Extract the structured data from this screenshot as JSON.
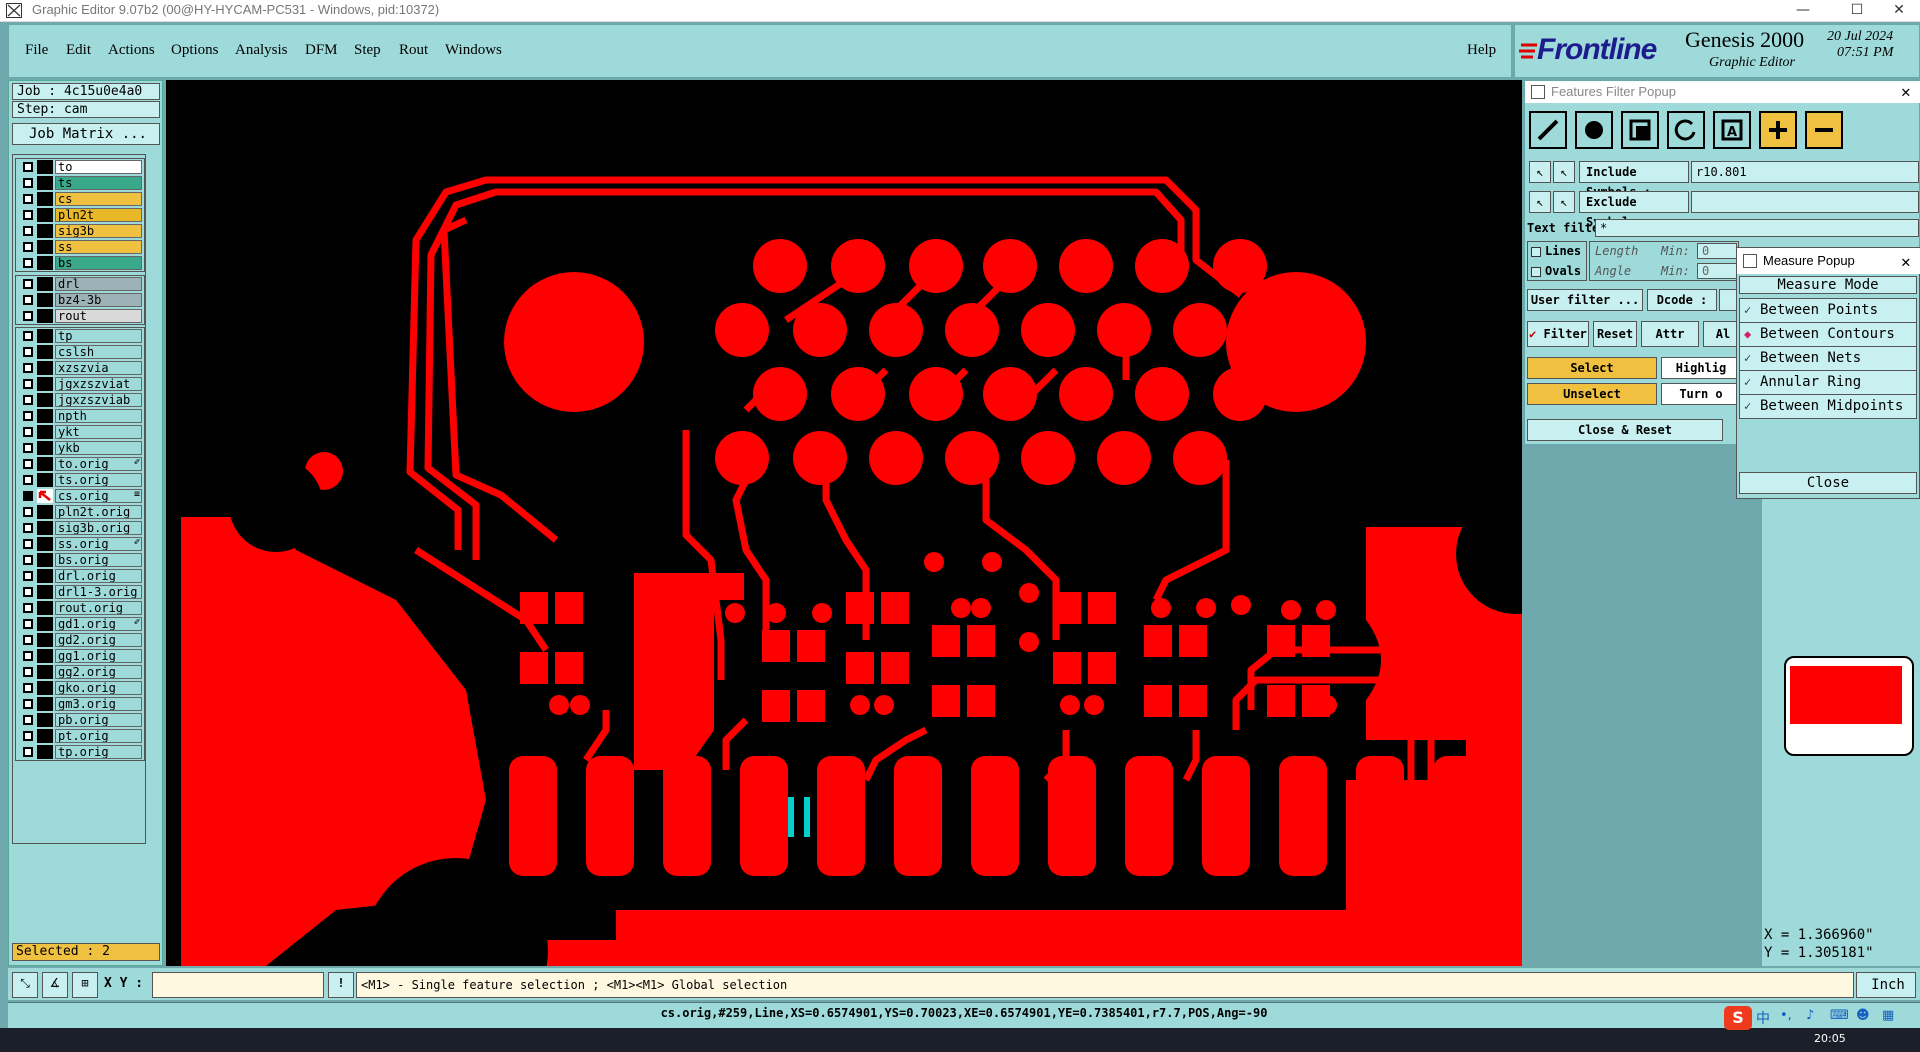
{
  "window": {
    "title": "Graphic Editor 9.07b2 (00@HY-HYCAM-PC531 - Windows, pid:10372)",
    "minimize": "—",
    "maximize": "☐",
    "close": "✕"
  },
  "menu": {
    "items": [
      "File",
      "Edit",
      "Actions",
      "Options",
      "Analysis",
      "DFM",
      "Step",
      "Rout",
      "Windows"
    ],
    "help": "Help"
  },
  "branding": {
    "company": "Frontline",
    "product": "Genesis 2000",
    "module": "Graphic Editor",
    "date": "20 Jul 2024",
    "time": "07:51 PM"
  },
  "job": {
    "job_label": "Job : 4c15u0e4a0",
    "step_label": "Step: cam",
    "matrix_button": "Job Matrix ..."
  },
  "layers": {
    "group1": [
      {
        "name": "to",
        "color": "#ffffff"
      },
      {
        "name": "ts",
        "color": "#3aa88a"
      },
      {
        "name": "cs",
        "color": "#f0c040"
      },
      {
        "name": "pln2t",
        "color": "#e8b828"
      },
      {
        "name": "sig3b",
        "color": "#f0c040"
      },
      {
        "name": "ss",
        "color": "#f0c040"
      },
      {
        "name": "bs",
        "color": "#3aa88a"
      }
    ],
    "group2": [
      {
        "name": "drl",
        "color": "#9db2b6"
      },
      {
        "name": "bz4-3b",
        "color": "#9db2b6"
      },
      {
        "name": "rout",
        "color": "#d9d9d9"
      }
    ],
    "group3": [
      {
        "name": "tp",
        "ext": ""
      },
      {
        "name": "cslsh",
        "ext": ""
      },
      {
        "name": "xzszvia",
        "ext": ""
      },
      {
        "name": "jgxzszviat",
        "ext": ""
      },
      {
        "name": "jgxzszviab",
        "ext": ""
      },
      {
        "name": "npth",
        "ext": ""
      },
      {
        "name": "ykt",
        "ext": ""
      },
      {
        "name": "ykb",
        "ext": ""
      },
      {
        "name": "to.orig",
        "ext": "✐"
      },
      {
        "name": "ts.orig",
        "ext": ""
      },
      {
        "name": "cs.orig",
        "ext": "≡",
        "active": true
      },
      {
        "name": "pln2t.orig",
        "ext": ""
      },
      {
        "name": "sig3b.orig",
        "ext": ""
      },
      {
        "name": "ss.orig",
        "ext": "✐"
      },
      {
        "name": "bs.orig",
        "ext": ""
      },
      {
        "name": "drl.orig",
        "ext": ""
      },
      {
        "name": "drl1-3.orig",
        "ext": ""
      },
      {
        "name": "rout.orig",
        "ext": ""
      },
      {
        "name": "gd1.orig",
        "ext": "✐"
      },
      {
        "name": "gd2.orig",
        "ext": ""
      },
      {
        "name": "gg1.orig",
        "ext": ""
      },
      {
        "name": "gg2.orig",
        "ext": ""
      },
      {
        "name": "gko.orig",
        "ext": ""
      },
      {
        "name": "gm3.orig",
        "ext": ""
      },
      {
        "name": "pb.orig",
        "ext": ""
      },
      {
        "name": "pt.orig",
        "ext": ""
      },
      {
        "name": "tp.orig",
        "ext": ""
      }
    ],
    "selected": "Selected : 2"
  },
  "features_filter": {
    "title": "Features Filter Popup",
    "include_label": "Include Symbols :",
    "include_value": "r10.801",
    "exclude_label": "Exclude Symbols :",
    "exclude_value": "",
    "text_filter_label": "Text filter",
    "text_filter_value": "*",
    "lines": "Lines",
    "ovals": "Ovals",
    "length": "Length",
    "angle": "Angle",
    "min": "Min:",
    "min_value": "0",
    "user_filter": "User filter ...",
    "dcode": "Dcode :",
    "filter": "Filter",
    "reset": "Reset",
    "attr": "Attr ...",
    "al": "Al",
    "select": "Select",
    "unselect": "Unselect",
    "highlight": "Highlig",
    "turn_off": "Turn o",
    "close_reset": "Close & Reset"
  },
  "measure": {
    "title": "Measure Popup",
    "mode_label": "Measure Mode",
    "options": [
      "Between Points",
      "Between Contours",
      "Between Nets",
      "Annular Ring",
      "Between Midpoints"
    ],
    "active_index": 1,
    "close": "Close"
  },
  "coords": {
    "x": "X = 1.366960\"",
    "y": "Y = 1.305181\""
  },
  "command": {
    "xy_label": "X Y :",
    "xy_value": "",
    "hint": "<M1> - Single feature selection ; <M1><M1> Global selection",
    "units": "Inch"
  },
  "status": {
    "text": "cs.orig,#259,Line,XS=0.6574901,YS=0.70023,XE=0.6574901,YE=0.7385401,r7.7,POS,Ang=-90"
  },
  "taskbar": {
    "clock": "20:05",
    "ime": "中"
  },
  "colors": {
    "copper": "#ff0000",
    "highlight": "#00d0d0",
    "panel": "#9fdada",
    "field": "#c9f0f0",
    "yellow": "#f0c040"
  }
}
